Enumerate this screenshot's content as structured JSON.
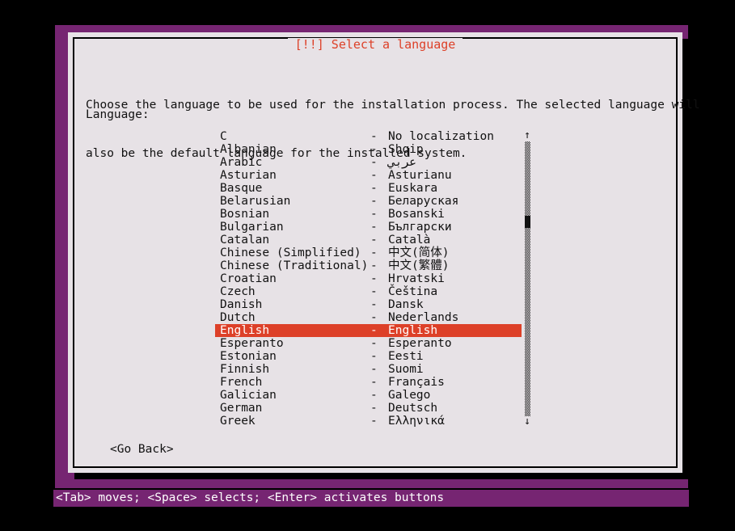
{
  "dialog": {
    "title": "[!!] Select a language",
    "description_line1": "Choose the language to be used for the installation process. The selected language will",
    "description_line2": "also be the default language for the installed system.",
    "field_label": "Language:",
    "go_back_label": "<Go Back>",
    "separator": "-"
  },
  "colors": {
    "accent": "#dd4028",
    "backdrop": "#762572",
    "dialog_bg": "#e7e2e6",
    "text": "#111111",
    "selected_text": "#ffffff"
  },
  "scrollbar": {
    "up_arrow": "↑",
    "down_arrow": "↓"
  },
  "languages": [
    {
      "english": "C",
      "native": "No localization",
      "selected": false
    },
    {
      "english": "Albanian",
      "native": "Shqip",
      "selected": false
    },
    {
      "english": "Arabic",
      "native": "عربي",
      "selected": false
    },
    {
      "english": "Asturian",
      "native": "Asturianu",
      "selected": false
    },
    {
      "english": "Basque",
      "native": "Euskara",
      "selected": false
    },
    {
      "english": "Belarusian",
      "native": "Беларуская",
      "selected": false
    },
    {
      "english": "Bosnian",
      "native": "Bosanski",
      "selected": false
    },
    {
      "english": "Bulgarian",
      "native": "Български",
      "selected": false
    },
    {
      "english": "Catalan",
      "native": "Català",
      "selected": false
    },
    {
      "english": "Chinese (Simplified)",
      "native": "中文(简体)",
      "selected": false
    },
    {
      "english": "Chinese (Traditional)",
      "native": "中文(繁體)",
      "selected": false
    },
    {
      "english": "Croatian",
      "native": "Hrvatski",
      "selected": false
    },
    {
      "english": "Czech",
      "native": "Čeština",
      "selected": false
    },
    {
      "english": "Danish",
      "native": "Dansk",
      "selected": false
    },
    {
      "english": "Dutch",
      "native": "Nederlands",
      "selected": false
    },
    {
      "english": "English",
      "native": "English",
      "selected": true
    },
    {
      "english": "Esperanto",
      "native": "Esperanto",
      "selected": false
    },
    {
      "english": "Estonian",
      "native": "Eesti",
      "selected": false
    },
    {
      "english": "Finnish",
      "native": "Suomi",
      "selected": false
    },
    {
      "english": "French",
      "native": "Français",
      "selected": false
    },
    {
      "english": "Galician",
      "native": "Galego",
      "selected": false
    },
    {
      "english": "German",
      "native": "Deutsch",
      "selected": false
    },
    {
      "english": "Greek",
      "native": "Ελληνικά",
      "selected": false
    }
  ],
  "statusbar": {
    "hint": "<Tab> moves; <Space> selects; <Enter> activates buttons"
  }
}
